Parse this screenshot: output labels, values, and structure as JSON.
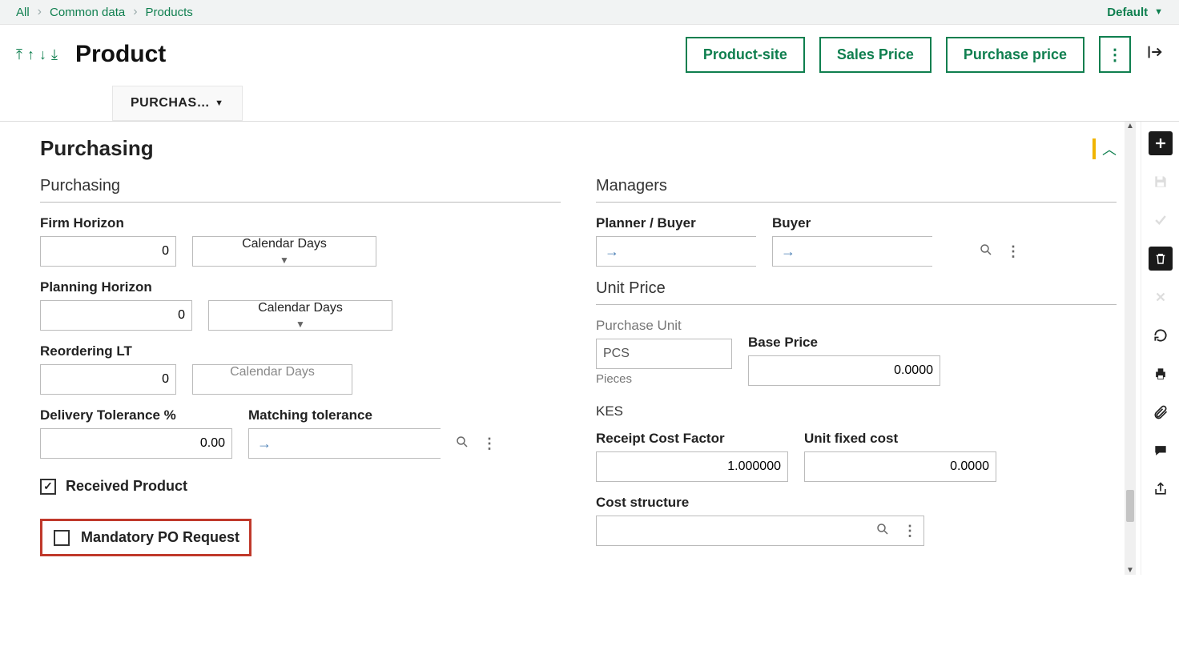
{
  "breadcrumb": {
    "items": [
      "All",
      "Common data",
      "Products"
    ],
    "view": "Default"
  },
  "header": {
    "title": "Product",
    "actions": {
      "product_site": "Product-site",
      "sales_price": "Sales Price",
      "purchase_price": "Purchase price"
    },
    "tab_label": "PURCHAS…"
  },
  "section": {
    "title": "Purchasing"
  },
  "left": {
    "group_title": "Purchasing",
    "firm_horizon_label": "Firm Horizon",
    "firm_horizon_value": "0",
    "firm_horizon_unit": "Calendar Days",
    "planning_horizon_label": "Planning Horizon",
    "planning_horizon_value": "0",
    "planning_horizon_unit": "Calendar Days",
    "reordering_lt_label": "Reordering LT",
    "reordering_lt_value": "0",
    "reordering_lt_unit": "Calendar Days",
    "delivery_tol_label": "Delivery Tolerance %",
    "delivery_tol_value": "0.00",
    "matching_tol_label": "Matching tolerance",
    "received_product_label": "Received Product",
    "received_product_checked": true,
    "mandatory_po_label": "Mandatory PO Request",
    "mandatory_po_checked": false
  },
  "right": {
    "managers_title": "Managers",
    "planner_buyer_label": "Planner / Buyer",
    "buyer_label": "Buyer",
    "unit_price_title": "Unit Price",
    "purchase_unit_label": "Purchase Unit",
    "purchase_unit_value": "PCS",
    "purchase_unit_hint": "Pieces",
    "base_price_label": "Base Price",
    "base_price_value": "0.0000",
    "currency_label": "KES",
    "receipt_cost_label": "Receipt Cost Factor",
    "receipt_cost_value": "1.000000",
    "unit_fixed_cost_label": "Unit fixed cost",
    "unit_fixed_cost_value": "0.0000",
    "cost_structure_label": "Cost structure"
  }
}
